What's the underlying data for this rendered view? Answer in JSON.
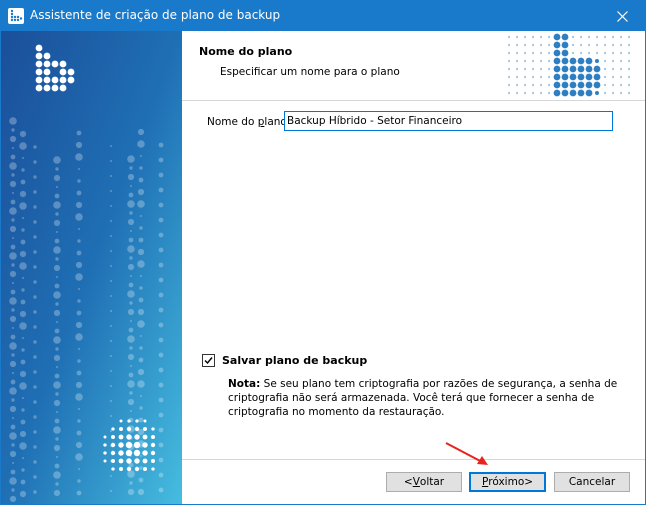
{
  "window": {
    "title": "Assistente de criação de plano de backup",
    "app_icon": "backup-app-icon",
    "close_icon": "close-icon"
  },
  "header": {
    "title": "Nome do plano",
    "subtitle": "Especificar um nome para o plano"
  },
  "form": {
    "name_label_prefix": "Nome do ",
    "name_label_underlined": "p",
    "name_label_suffix": "lano:",
    "name_value": "Backup Híbrido - Setor Financeiro",
    "save_checkbox_checked": true,
    "save_checkbox_label": "Salvar plano de backup",
    "note_label": "Nota:",
    "note_text": " Se seu plano tem criptografia por razões de segurança, a senha de criptografia não será armazenada. Você terá que fornecer a senha de criptografia no momento da restauração."
  },
  "buttons": {
    "back_prefix": "<",
    "back_underlined": "V",
    "back_suffix": "oltar",
    "next_prefix": "",
    "next_underlined": "P",
    "next_suffix": "róximo>",
    "cancel": "Cancelar"
  },
  "colors": {
    "titlebar": "#1979ca",
    "panel_top": "#1b5fa8",
    "panel_bottom": "#3fb4d9",
    "accent": "#0078d7",
    "annotation_arrow": "#e8231c"
  }
}
